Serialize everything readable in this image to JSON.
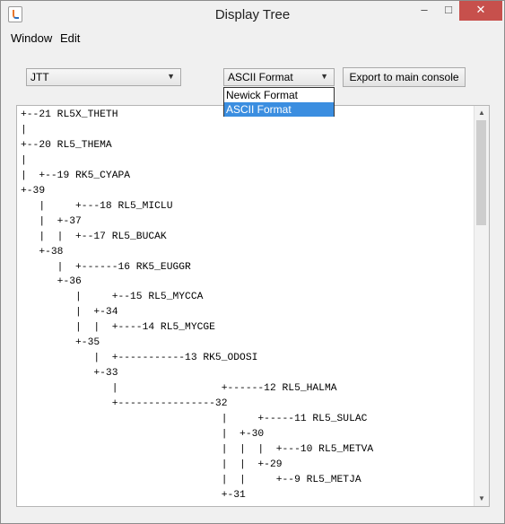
{
  "window": {
    "title": "Display Tree",
    "buttons": {
      "minimize": "–",
      "maximize": "□",
      "close": "✕"
    }
  },
  "menu": {
    "items": [
      "Window",
      "Edit"
    ]
  },
  "toolbar": {
    "method_value": "JTT",
    "format_value": "ASCII Format",
    "export_label": "Export to main console"
  },
  "format_dropdown": {
    "options": [
      "Newick Format",
      "ASCII Format"
    ],
    "selected": "ASCII Format"
  },
  "tree_text": "+--21 RL5X_THETH\n|\n+--20 RL5_THEMA\n|\n|  +--19 RK5_CYAPA\n+-39\n   |     +---18 RL5_MICLU\n   |  +-37\n   |  |  +--17 RL5_BUCAK\n   +-38\n      |  +------16 RK5_EUGGR\n      +-36\n         |     +--15 RL5_MYCCA\n         |  +-34\n         |  |  +----14 RL5_MYCGE\n         +-35\n            |  +-----------13 RK5_ODOSI\n            +-33\n               |                 +------12 RL5_HALMA\n               +----------------32\n                                 |     +-----11 RL5_SULAC\n                                 |  +-30\n                                 |  |  |  +---10 RL5_METVA\n                                 |  |  +-29\n                                 |  |     +--9 RL5_METJA\n                                 +-31",
  "icons": {
    "app": "java-app-icon",
    "combo_arrow": "chevron-down-icon"
  }
}
